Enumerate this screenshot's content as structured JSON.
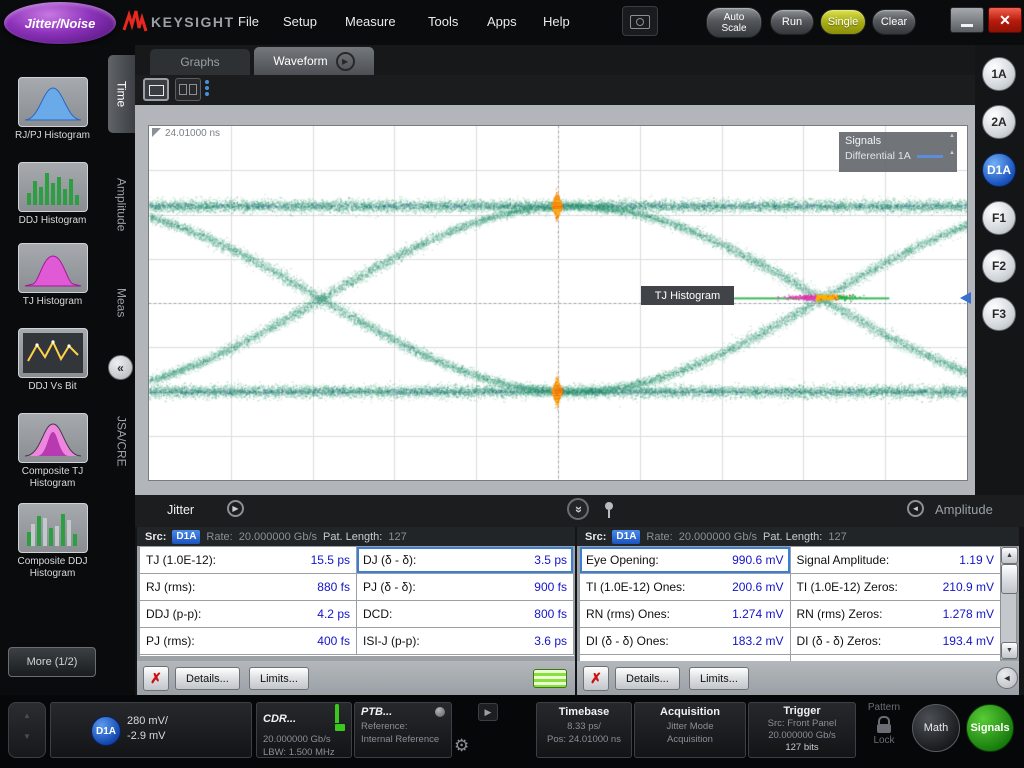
{
  "titlebar": {
    "app_badge": "Jitter/Noise",
    "brand": "KEYSIGHT",
    "menus": [
      "File",
      "Setup",
      "Measure",
      "Tools",
      "Apps",
      "Help"
    ],
    "auto_scale": "Auto Scale",
    "run": "Run",
    "single": "Single",
    "clear": "Clear"
  },
  "sidebar": {
    "items": [
      {
        "label": "RJ/PJ Histogram"
      },
      {
        "label": "DDJ Histogram"
      },
      {
        "label": "TJ Histogram"
      },
      {
        "label": "DDJ Vs Bit"
      },
      {
        "label": "Composite TJ Histogram"
      },
      {
        "label": "Composite DDJ Histogram"
      }
    ],
    "more": "More (1/2)"
  },
  "left_tabs": [
    "Time",
    "Amplitude",
    "Meas",
    "JSA/CRE"
  ],
  "main_tabs": {
    "graphs": "Graphs",
    "waveform": "Waveform"
  },
  "waveform": {
    "delay": "24.01000 ns",
    "legend_title": "Signals",
    "legend_entry": "Differential 1A",
    "tj_label": "TJ Histogram"
  },
  "channels": [
    "1A",
    "2A",
    "D1A",
    "F1",
    "F2",
    "F3"
  ],
  "jitter": {
    "title": "Jitter",
    "src_label": "Src:",
    "src": "D1A",
    "rate_label": "Rate:",
    "rate": "20.000000 Gb/s",
    "pat_label": "Pat. Length:",
    "pat": "127",
    "rows": [
      {
        "l1": "TJ (1.0E-12):",
        "v1": "15.5 ps",
        "l2": "DJ (δ - δ):",
        "v2": "3.5 ps"
      },
      {
        "l1": "RJ (rms):",
        "v1": "880 fs",
        "l2": "PJ (δ - δ):",
        "v2": "900 fs"
      },
      {
        "l1": "DDJ (p-p):",
        "v1": "4.2 ps",
        "l2": "DCD:",
        "v2": "800 fs"
      },
      {
        "l1": "PJ (rms):",
        "v1": "400 fs",
        "l2": "ISI-J (p-p):",
        "v2": "3.6 ps"
      }
    ],
    "details": "Details...",
    "limits": "Limits..."
  },
  "amplitude": {
    "title": "Amplitude",
    "src_label": "Src:",
    "src": "D1A",
    "rate_label": "Rate:",
    "rate": "20.000000 Gb/s",
    "pat_label": "Pat. Length:",
    "pat": "127",
    "rows": [
      {
        "l1": "Eye Opening:",
        "v1": "990.6 mV",
        "l2": "Signal Amplitude:",
        "v2": "1.19 V"
      },
      {
        "l1": "TI (1.0E-12) Ones:",
        "v1": "200.6 mV",
        "l2": "TI (1.0E-12) Zeros:",
        "v2": "210.9 mV"
      },
      {
        "l1": "RN (rms) Ones:",
        "v1": "1.274 mV",
        "l2": "RN (rms) Zeros:",
        "v2": "1.278 mV"
      },
      {
        "l1": "DI (δ - δ) Ones:",
        "v1": "183.2 mV",
        "l2": "DI (δ - δ) Zeros:",
        "v2": "193.4 mV"
      }
    ],
    "details": "Details...",
    "limits": "Limits..."
  },
  "statusbar": {
    "channel_badge": "D1A",
    "channel_scale": "280 mV/",
    "channel_offset": "-2.9 mV",
    "cdr_title": "CDR...",
    "cdr_rate": "20.000000 Gb/s",
    "cdr_lbw": "LBW: 1.500 MHz",
    "ptb_title": "PTB...",
    "ptb_line1": "Reference:",
    "ptb_line2": "Internal Reference",
    "tb_title": "Timebase",
    "tb_scale": "8.33 ps/",
    "tb_pos": "Pos: 24.01000 ns",
    "acq_title": "Acquisition",
    "acq_line1": "Jitter Mode",
    "acq_line2": "Acquisition",
    "trig_title": "Trigger",
    "trig_line1": "Src: Front Panel",
    "trig_line2": "20.000000 Gb/s",
    "trig_line3": "127 bits",
    "pattern_line1": "Pattern",
    "pattern_line2": "Lock",
    "math": "Math",
    "signals": "Signals"
  }
}
